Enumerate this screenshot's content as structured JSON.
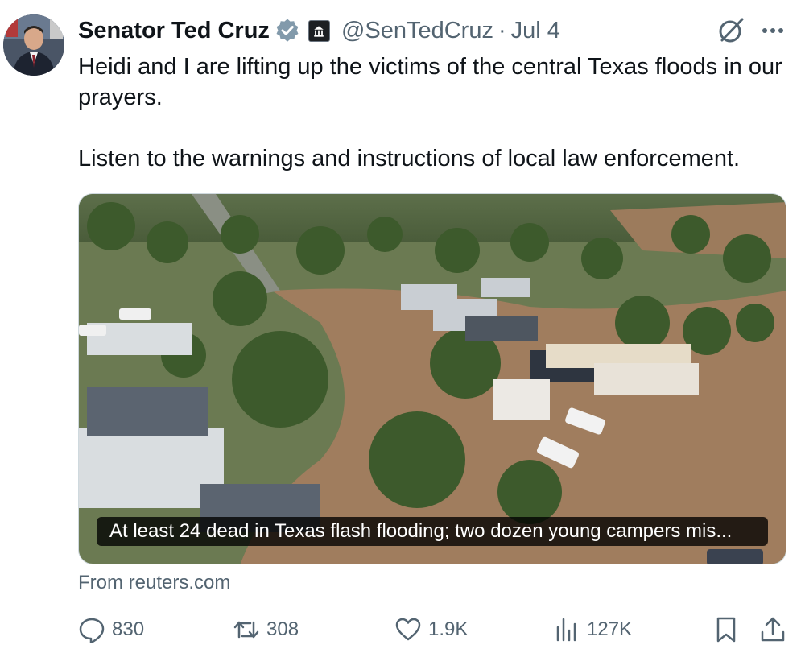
{
  "author": {
    "display_name": "Senator Ted Cruz",
    "handle": "@SenTedCruz",
    "separator": "·",
    "date": "Jul 4",
    "verified_icon": "verified-badge-icon",
    "affiliation_icon": "government-badge-icon"
  },
  "tweet": {
    "text_line1": "Heidi and I are lifting up the victims of the central Texas floods in our prayers.",
    "text_line2": "Listen to the warnings and instructions of local law enforcement."
  },
  "card": {
    "caption": "At least 24 dead in Texas flash flooding; two dozen young campers mis...",
    "source": "From reuters.com"
  },
  "actions": {
    "replies": "830",
    "reposts": "308",
    "likes": "1.9K",
    "views": "127K"
  },
  "colors": {
    "text": "#0f1419",
    "secondary": "#536471",
    "verified": "#829aab",
    "flood_water": "#a07d5e"
  }
}
